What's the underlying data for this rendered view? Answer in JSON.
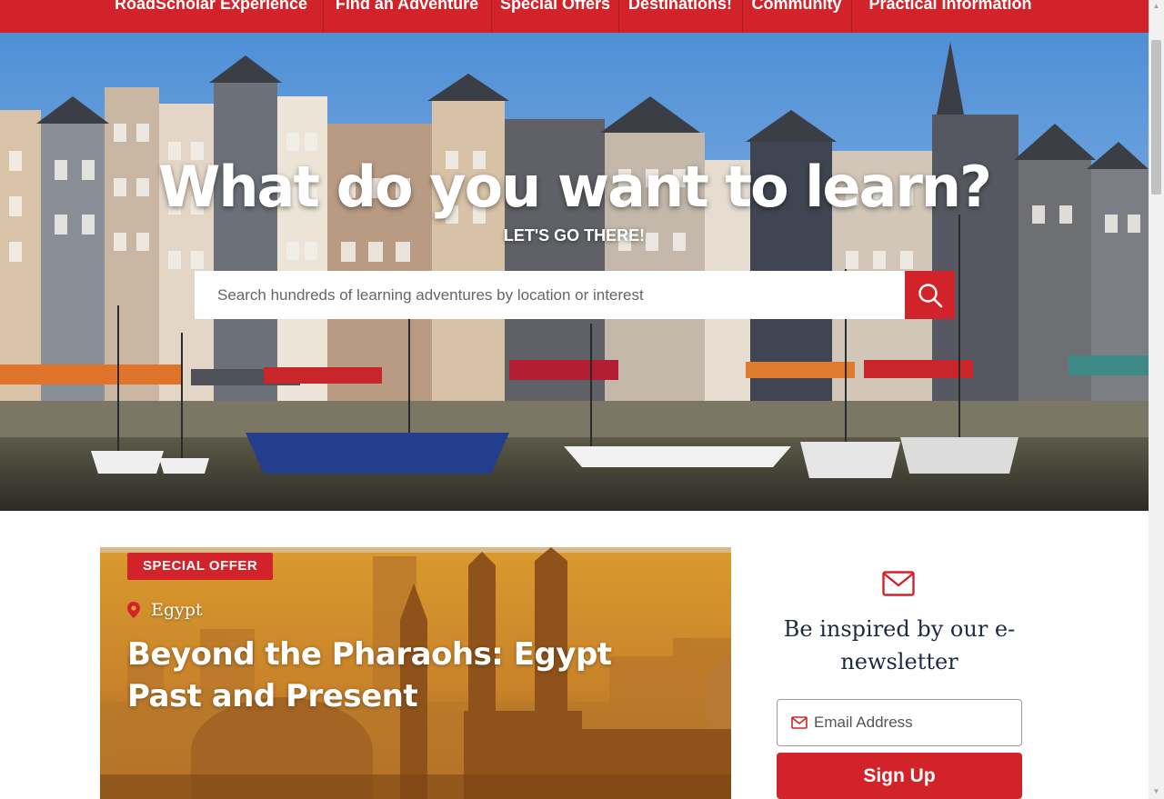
{
  "nav": {
    "items": [
      {
        "label": "RoadScholar Experience"
      },
      {
        "label": "Find an Adventure"
      },
      {
        "label": "Special Offers"
      },
      {
        "label": "Destinations!"
      },
      {
        "label": "Community"
      },
      {
        "label": "Practical Information"
      }
    ]
  },
  "hero": {
    "title": "What do you want to learn?",
    "subtitle": "LET'S GO THERE!",
    "search": {
      "placeholder": "Search hundreds of learning adventures by location or interest",
      "button_icon": "search-icon"
    }
  },
  "offer": {
    "badge": "SPECIAL OFFER",
    "location": "Egypt",
    "location_icon": "map-pin-icon",
    "title": "Beyond the Pharaohs: Egypt Past and Present"
  },
  "newsletter": {
    "icon": "envelope-icon",
    "title": "Be inspired by our e-newsletter",
    "email_placeholder": "Email Address",
    "signup_label": "Sign Up"
  },
  "colors": {
    "brand_red": "#d2232a",
    "navy_text": "#1d2a44"
  }
}
